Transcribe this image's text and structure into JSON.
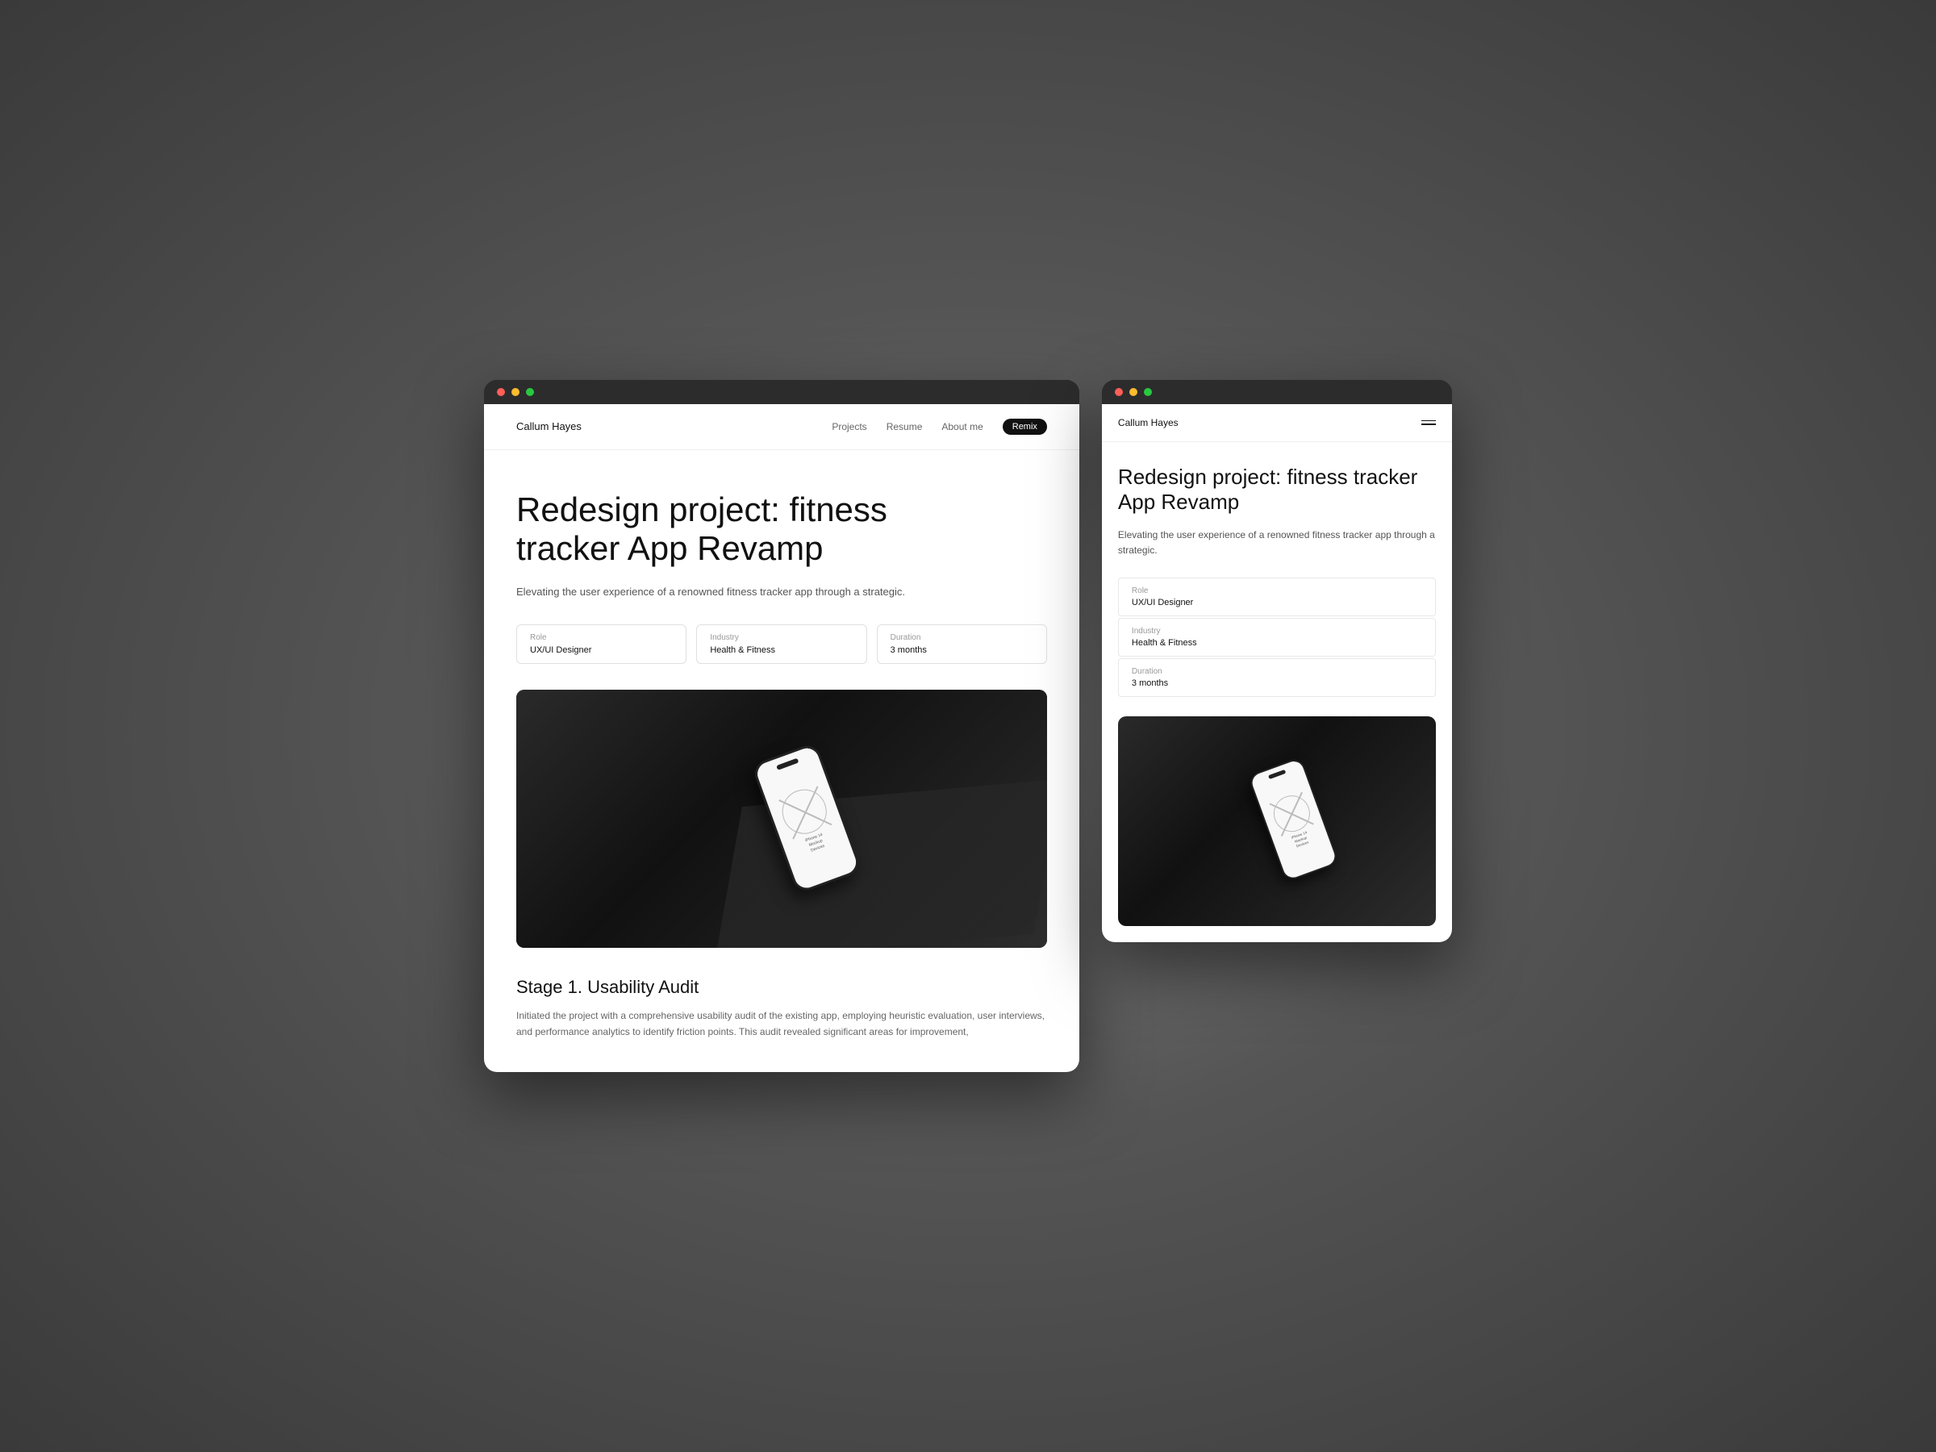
{
  "desktop": {
    "nav": {
      "logo": "Callum Hayes",
      "links": [
        {
          "label": "Projects",
          "active": false
        },
        {
          "label": "Resume",
          "active": false
        },
        {
          "label": "About me",
          "active": false
        },
        {
          "label": "Remix",
          "active": true
        }
      ]
    },
    "page": {
      "title": "Redesign project: fitness tracker App Revamp",
      "subtitle": "Elevating the user experience of a renowned fitness tracker app through a strategic.",
      "meta": [
        {
          "label": "Role",
          "value": "UX/UI Designer"
        },
        {
          "label": "Industry",
          "value": "Health & Fitness"
        },
        {
          "label": "Duration",
          "value": "3 months"
        }
      ],
      "phone_mockup": {
        "line1": "iPhone 14",
        "line2": "Mockup",
        "line3": "Devices"
      },
      "stage": {
        "title": "Stage 1. Usability Audit",
        "text": "Initiated the project with a comprehensive usability audit of the existing app, employing heuristic evaluation, user interviews, and performance analytics to identify friction points. This audit revealed significant areas for improvement,"
      }
    }
  },
  "mobile": {
    "nav": {
      "logo": "Callum Hayes",
      "menu_icon": "hamburger"
    },
    "page": {
      "title": "Redesign project: fitness tracker App Revamp",
      "subtitle": "Elevating the user experience of a renowned fitness tracker app through a strategic.",
      "meta": [
        {
          "label": "Role",
          "value": "UX/UI Designer"
        },
        {
          "label": "Industry",
          "value": "Health & Fitness"
        },
        {
          "label": "Duration",
          "value": "3 months"
        }
      ],
      "phone_mockup": {
        "line1": "iPhone 14",
        "line2": "Mockup",
        "line3": "Devices"
      }
    }
  }
}
